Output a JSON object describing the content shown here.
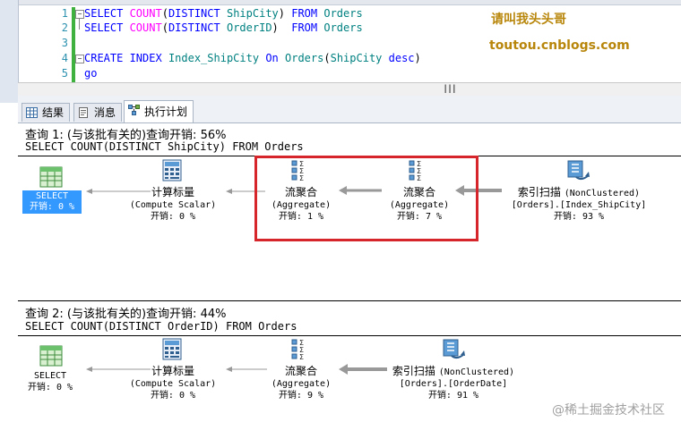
{
  "editor": {
    "line_numbers": [
      "1",
      "2",
      "3",
      "4",
      "5"
    ],
    "lines": [
      {
        "tokens": [
          {
            "t": "SELECT ",
            "c": "kw"
          },
          {
            "t": "COUNT",
            "c": "fn"
          },
          {
            "t": "(",
            "c": ""
          },
          {
            "t": "DISTINCT ",
            "c": "kw"
          },
          {
            "t": "ShipCity",
            "c": "id"
          },
          {
            "t": ") ",
            "c": ""
          },
          {
            "t": "FROM ",
            "c": "kw"
          },
          {
            "t": "Orders",
            "c": "id"
          }
        ]
      },
      {
        "tokens": [
          {
            "t": "SELECT ",
            "c": "kw"
          },
          {
            "t": "COUNT",
            "c": "fn"
          },
          {
            "t": "(",
            "c": ""
          },
          {
            "t": "DISTINCT ",
            "c": "kw"
          },
          {
            "t": "OrderID",
            "c": "id"
          },
          {
            "t": ")  ",
            "c": ""
          },
          {
            "t": "FROM ",
            "c": "kw"
          },
          {
            "t": "Orders",
            "c": "id"
          }
        ]
      },
      {
        "tokens": []
      },
      {
        "tokens": [
          {
            "t": "CREATE ",
            "c": "kw"
          },
          {
            "t": "INDEX ",
            "c": "kw"
          },
          {
            "t": "Index_ShipCity ",
            "c": "id"
          },
          {
            "t": "On ",
            "c": "kw"
          },
          {
            "t": "Orders",
            "c": "id"
          },
          {
            "t": "(",
            "c": ""
          },
          {
            "t": "ShipCity ",
            "c": "id"
          },
          {
            "t": "desc",
            "c": "kw"
          },
          {
            "t": ")",
            "c": ""
          }
        ]
      },
      {
        "tokens": [
          {
            "t": "go",
            "c": "kw"
          }
        ]
      }
    ]
  },
  "watermark": {
    "name": "请叫我头头哥",
    "site": "toutou.cnblogs.com"
  },
  "tabs": [
    {
      "label": "结果",
      "icon": "grid-icon"
    },
    {
      "label": "消息",
      "icon": "messages-icon"
    },
    {
      "label": "执行计划",
      "icon": "execution-plan-icon",
      "active": true
    }
  ],
  "plans": [
    {
      "header": "查询 1: (与该批有关的)查询开销: 56%",
      "sql": "SELECT COUNT(DISTINCT ShipCity) FROM Orders",
      "nodes": {
        "select": {
          "name": "SELECT",
          "cost": "开销: 0 %"
        },
        "compute": {
          "name": "计算标量",
          "sub": "(Compute Scalar)",
          "cost": "开销: 0 %"
        },
        "agg1": {
          "name": "流聚合",
          "sub": "(Aggregate)",
          "cost": "开销: 1 %"
        },
        "agg2": {
          "name": "流聚合",
          "sub": "(Aggregate)",
          "cost": "开销: 7 %"
        },
        "scan": {
          "name": "索引扫描",
          "sub_type": "(NonClustered)",
          "sub": "[Orders].[Index_ShipCity]",
          "cost": "开销: 93 %"
        }
      }
    },
    {
      "header": "查询 2: (与该批有关的)查询开销: 44%",
      "sql": "SELECT COUNT(DISTINCT OrderID) FROM Orders",
      "nodes": {
        "select": {
          "name": "SELECT",
          "cost": "开销: 0 %"
        },
        "compute": {
          "name": "计算标量",
          "sub": "(Compute Scalar)",
          "cost": "开销: 0 %"
        },
        "agg1": {
          "name": "流聚合",
          "sub": "(Aggregate)",
          "cost": "开销: 9 %"
        },
        "scan": {
          "name": "索引扫描",
          "sub_type": "(NonClustered)",
          "sub": "[Orders].[OrderDate]",
          "cost": "开销: 91 %"
        }
      }
    }
  ],
  "footer_watermark": "@稀土掘金技术社区",
  "colors": {
    "highlight": "#d7262b",
    "keyword": "#0000ff",
    "function": "#ff00ff",
    "identifier": "#008080",
    "select_bg": "#3399ff"
  }
}
